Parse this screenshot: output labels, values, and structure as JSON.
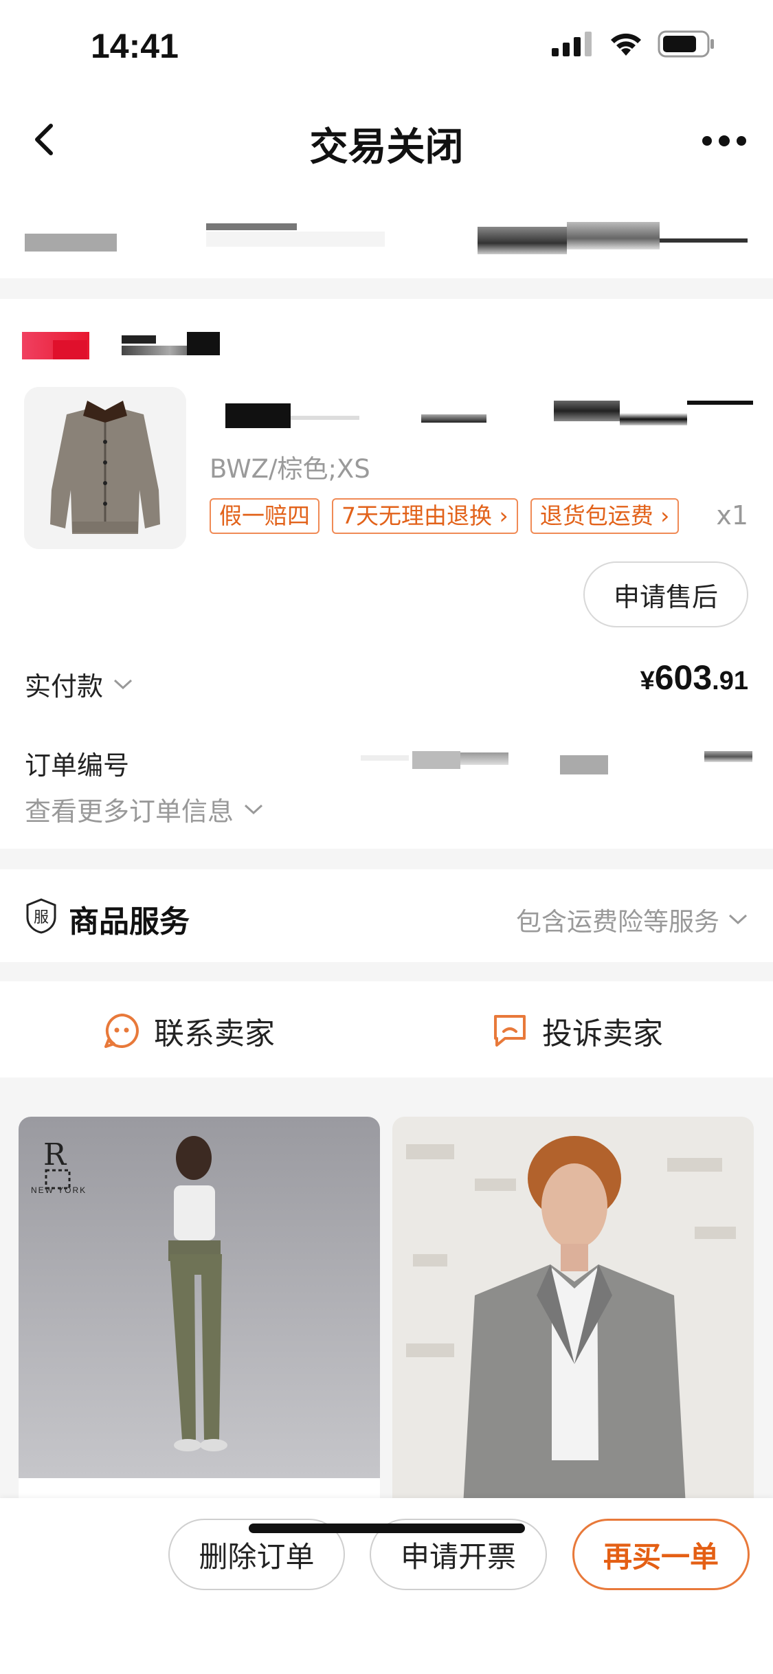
{
  "status_bar": {
    "time": "14:41"
  },
  "nav": {
    "title": "交易关闭"
  },
  "product": {
    "spec": "BWZ/棕色;XS",
    "tags": [
      "假一赔四",
      "7天无理由退换",
      "退货包运费"
    ],
    "quantity": "x1",
    "after_sale_label": "申请售后"
  },
  "payment": {
    "label": "实付款",
    "currency": "¥",
    "amount_int": "603",
    "amount_dec": ".91"
  },
  "order_info": {
    "order_no_label": "订单编号",
    "more_info_label": "查看更多订单信息"
  },
  "service": {
    "icon_char": "服",
    "title": "商品服务",
    "desc": "包含运费险等服务"
  },
  "contact": {
    "contact_seller": "联系卖家",
    "complain_seller": "投诉卖家"
  },
  "recommend": {
    "brand_logo_sub": "NEW YORK"
  },
  "actions": {
    "delete_order": "删除订单",
    "request_invoice": "申请开票",
    "buy_again": "再买一单"
  },
  "colors": {
    "accent": "#E45F14",
    "tag_border": "#F08A55",
    "page_bg": "#F5F5F5"
  }
}
